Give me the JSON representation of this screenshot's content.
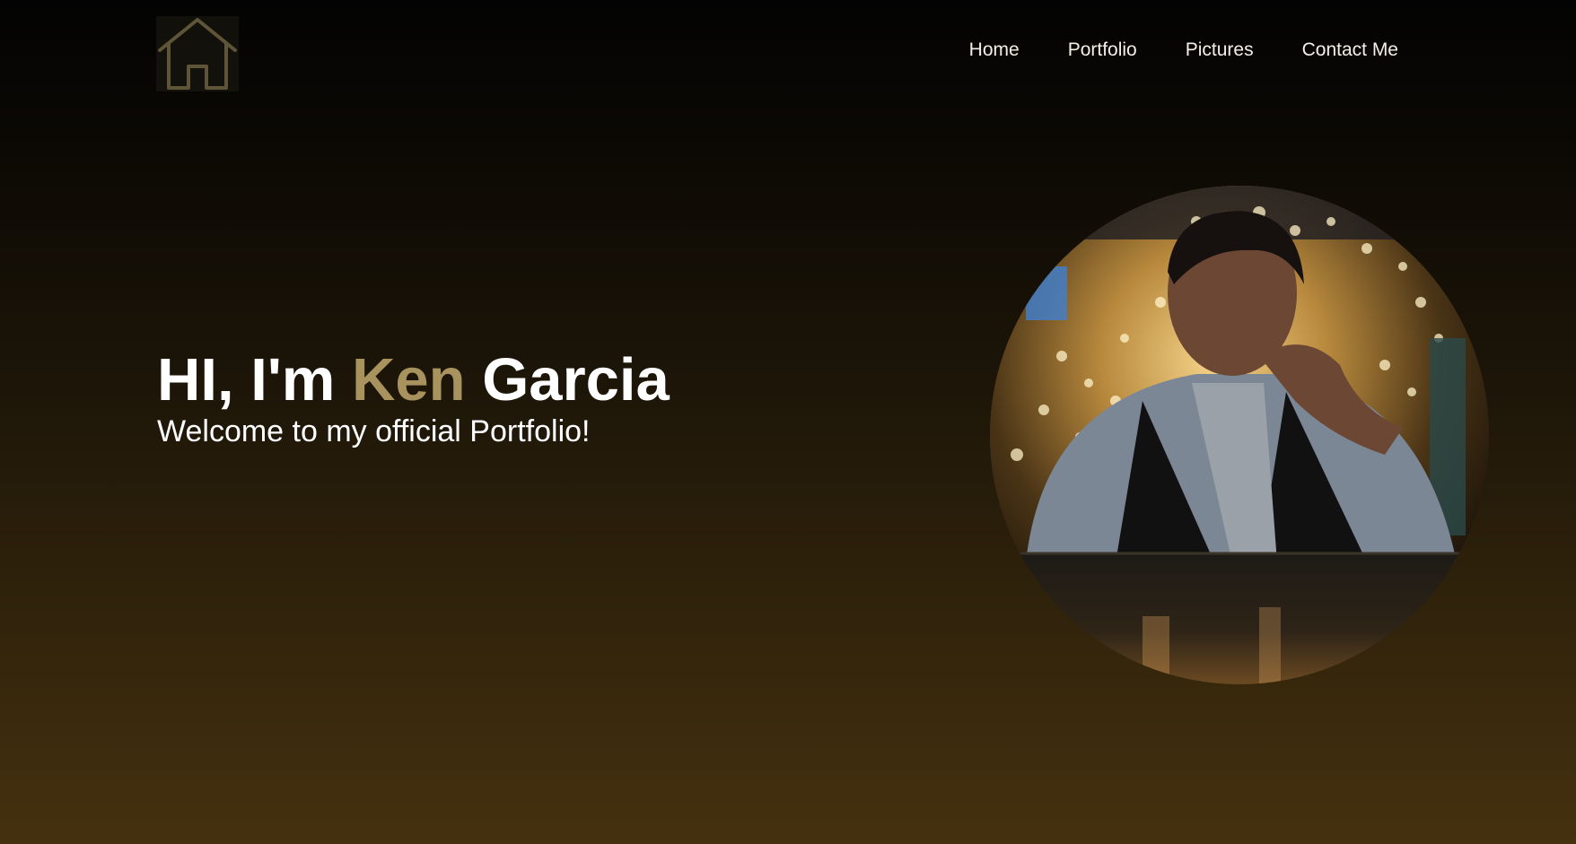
{
  "header": {
    "logo_icon": "house-icon",
    "nav": [
      {
        "label": "Home"
      },
      {
        "label": "Portfolio"
      },
      {
        "label": "Pictures"
      },
      {
        "label": "Contact Me"
      }
    ]
  },
  "hero": {
    "greeting": "HI, I'm",
    "first_name": "Ken",
    "last_name": "Garcia",
    "subtitle": "Welcome to my official Portfolio!",
    "accent_color": "#a8925e"
  }
}
